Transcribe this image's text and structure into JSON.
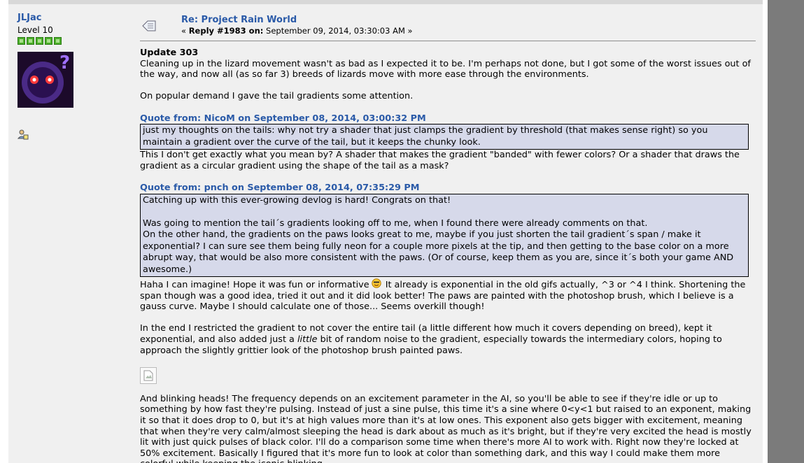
{
  "post": {
    "user": {
      "name": "JLJac",
      "rank": "Level 10",
      "stars": 5
    },
    "title": "Re: Project Rain World",
    "meta": {
      "prefix": "« ",
      "reply_label": "Reply #1983 on:",
      "date": " September 09, 2014, 03:30:03 AM »"
    },
    "update": "Update 303",
    "p1": "Cleaning up in the lizard movement wasn't as bad as I expected it to be. I'm perhaps not done, but I got some of the worst issues out of the way, and now all (as so far 3) breeds of lizards move with more ease through the environments.",
    "p2": "On popular demand I gave the tail gradients some attention.",
    "quote1": {
      "head": "Quote from: NicoM on September 08, 2014, 03:00:32 PM",
      "text": "just my thoughts on the tails: why not try a shader that just clamps the gradient by threshold (that makes sense right) so you maintain a gradient over the curve of the tail, but it keeps the chunky look."
    },
    "p3": "This I don't get exactly what you mean by? A shader that makes the gradient \"banded\" with fewer colors? Or a shader that draws the gradient as a circular gradient using the shape of the tail as a mask?",
    "quote2": {
      "head": "Quote from: pnch on September 08, 2014, 07:35:29 PM",
      "l1": "Catching up with this ever-growing devlog is hard! Congrats on that!",
      "l2": "Was going to mention the tail´s gradients looking off to me, when I found there were already comments on that.",
      "l3": "On the other hand, the gradients on the paws looks great to me, maybe if you just shorten the tail gradient´s span / make it exponential? I can sure see them being fully neon for a couple more pixels at the tip, and then getting to the base color on a more abrupt way, that would be also more consistent with the paws. (Or of course, keep them as you are, since it´s both your game AND awesome.)"
    },
    "p4a": "Haha I can imagine! Hope it was fun or informative",
    "p4b": " It already is exponential in the old gifs actually, ^3 or ^4 I think.  Shortening the span though was a good idea, tried it out and it did look better! The paws are painted with the photoshop brush, which I believe is a gauss curve. Maybe I should calculate one of those... Seems overkill though!",
    "p5a": "In the end I restricted the gradient to not cover the entire tail (a little different how much it covers depending on breed), kept it exponential, and also added just a ",
    "p5em": "little",
    "p5b": " bit of random noise to the gradient, especially towards the intermediary colors, hoping to approach the slightly grittier look of the photoshop brush painted paws.",
    "p6": "And blinking heads! The frequency depends on an excitement parameter in the AI, so you'll be able to see if they're idle or up to something by how fast they're pulsing. Instead of just a sine pulse, this time it's a sine where 0<y<1 but raised to an exponent, making it so that it does drop to 0, but it's at high values more than it's at low ones. This exponent also gets bigger with excitement, meaning that when they're very calm/almost sleeping the head is dark about as much as it's bright, but if they're very excited the head is mostly lit with just quick pulses of black color. I'll do a comparison some time when there's more AI to work with. Right now they're locked at 50% excitement. Basically I figured that it's more fun to look at color than something dark, and this way I could make them more colorful while keeping the iconic blinking."
  }
}
